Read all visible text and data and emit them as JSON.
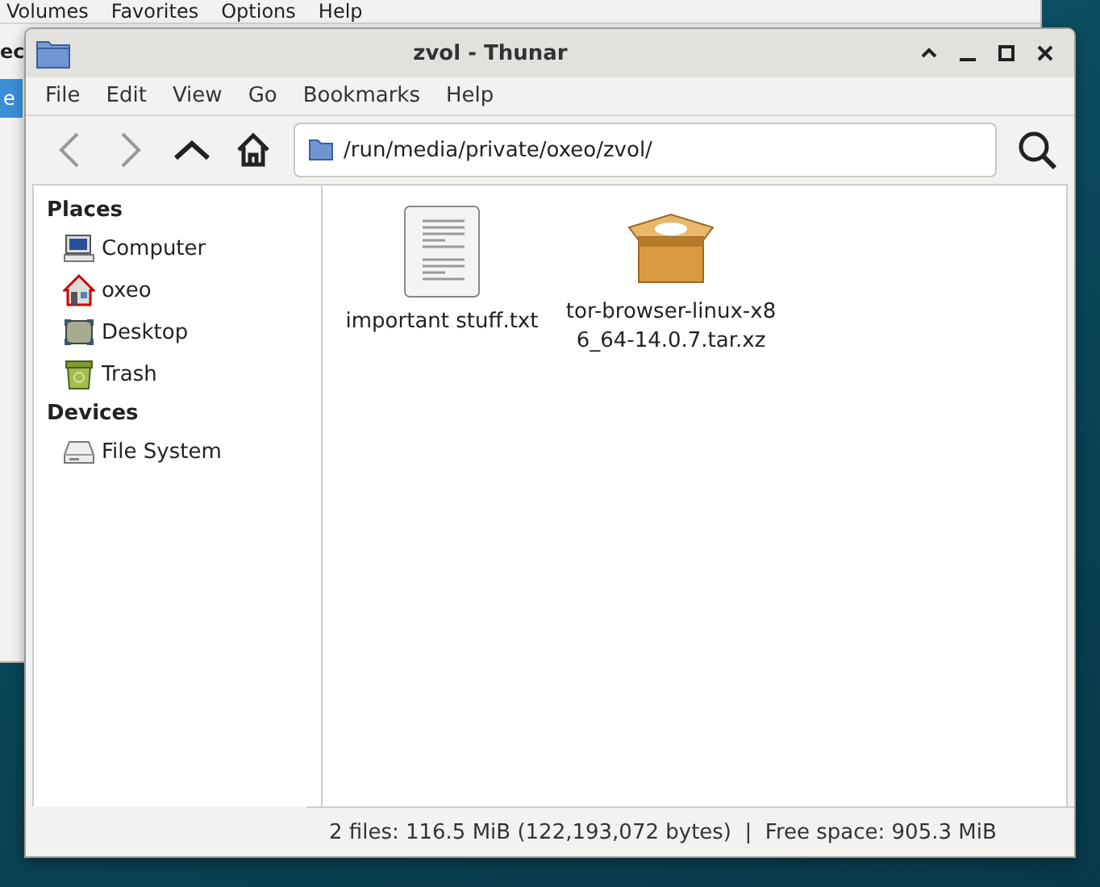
{
  "back_window": {
    "menu": [
      "Volumes",
      "Favorites",
      "Options",
      "Help"
    ],
    "sidebar_heading": "ec",
    "selected_item": "e"
  },
  "window": {
    "title": "zvol - Thunar"
  },
  "menu": [
    "File",
    "Edit",
    "View",
    "Go",
    "Bookmarks",
    "Help"
  ],
  "toolbar": {
    "back_disabled": true,
    "forward_disabled": true,
    "location": "/run/media/private/oxeo/zvol/"
  },
  "sidebar": [
    {
      "heading": "Places",
      "items": [
        {
          "label": "Computer",
          "kind": "computer"
        },
        {
          "label": "oxeo",
          "kind": "home"
        },
        {
          "label": "Desktop",
          "kind": "desktop"
        },
        {
          "label": "Trash",
          "kind": "trash"
        }
      ]
    },
    {
      "heading": "Devices",
      "items": [
        {
          "label": "File System",
          "kind": "drive"
        }
      ]
    }
  ],
  "files": [
    {
      "name": "important stuff.txt",
      "kind": "text"
    },
    {
      "name": "tor-browser-linux-x86_64-14.0.7.tar.xz",
      "kind": "archive"
    }
  ],
  "status_bar": "2 files: 116.5 MiB (122,193,072 bytes)  |  Free space: 905.3 MiB"
}
